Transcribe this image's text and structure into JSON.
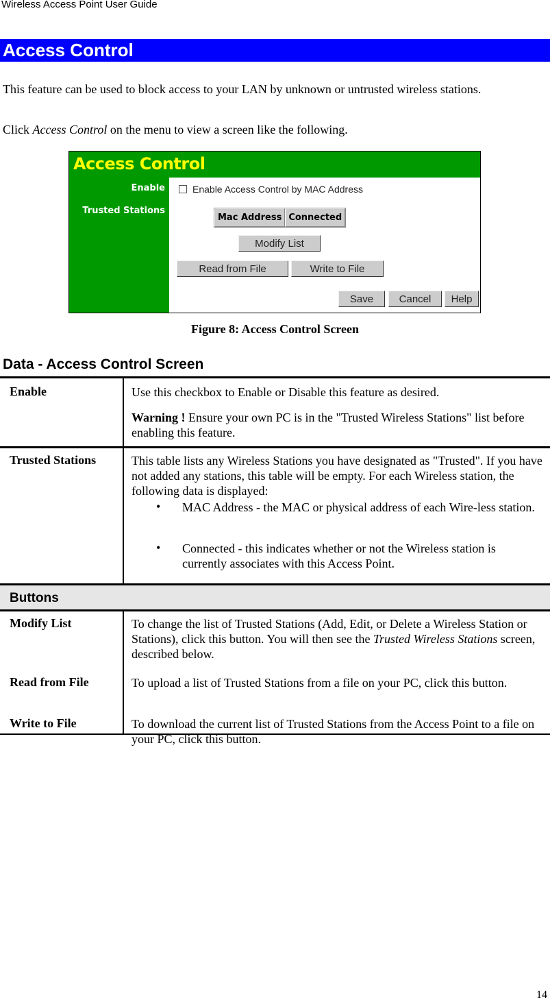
{
  "running_head": "Wireless Access Point User Guide",
  "section_title": "Access Control",
  "colors": {
    "section_bar": "#0000ff",
    "figure_green": "#009900",
    "figure_title": "#ffff00",
    "button_gray": "#cccccc",
    "band_gray": "#e6e6e6"
  },
  "intro": {
    "p1": "This feature can be used to block access to your LAN by unknown or untrusted wireless stations.",
    "p2_pre": "Click ",
    "p2_em": "Access Control",
    "p2_post": " on the menu to view a screen like the following."
  },
  "figure": {
    "title": "Access Control",
    "labels": {
      "enable": "Enable",
      "trusted": "Trusted Stations"
    },
    "checkbox_label": "Enable Access Control by MAC Address",
    "checkbox_checked": false,
    "table_headers": [
      "Mac Address",
      "Connected"
    ],
    "buttons": {
      "modify": "Modify List",
      "read": "Read from File",
      "write": "Write to File",
      "save": "Save",
      "cancel": "Cancel",
      "help": "Help"
    },
    "caption": "Figure 8: Access Control Screen"
  },
  "data_heading": "Data - Access Control Screen",
  "rows": {
    "enable": {
      "term": "Enable",
      "desc": "Use this checkbox to Enable or Disable this feature as desired.",
      "warn_bold": "Warning !",
      "warn_text": " Ensure your own PC is in the \"Trusted Wireless Stations\" list before enabling this feature."
    },
    "trusted": {
      "term": "Trusted Stations",
      "desc": "This table lists any Wireless Stations you have designated as \"Trusted\". If you have not added any stations, this table will be empty. For each Wireless station, the following data is displayed:",
      "bullets": [
        "MAC Address - the MAC or physical address of each Wire-less station.",
        "Connected - this indicates whether or not the Wireless station is currently associates with this Access Point."
      ]
    },
    "buttons_band": "Buttons",
    "modify": {
      "term": "Modify List",
      "desc_pre": "To change the list of Trusted Stations (Add, Edit, or Delete a Wireless Station or Stations), click this button. You will then see the ",
      "desc_em": "Trusted Wireless Stations",
      "desc_post": " screen, described below."
    },
    "read": {
      "term": "Read from File",
      "desc": "To upload a list of Trusted Stations from a file on your PC, click this button."
    },
    "write": {
      "term": "Write to File",
      "desc": "To download the current list of Trusted Stations from the Access Point to a file on your PC, click this button."
    }
  },
  "page_number": "14"
}
